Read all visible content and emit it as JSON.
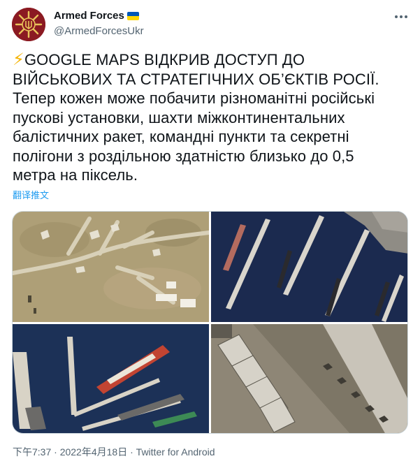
{
  "author": {
    "display_name": "Armed Forces",
    "handle": "@ArmedForcesUkr",
    "flag_colors": [
      "#0057b7",
      "#ffd700"
    ],
    "avatar_bg": "#8b1a22",
    "avatar_icon": "ukraine-armed-forces-emblem"
  },
  "tweet": {
    "headline_line1": "GOOGLE MAPS ВІДКРИВ ДОСТУП ДО",
    "headline_line2": "ВІЙСЬКОВИХ ТА СТРАТЕГІЧНИХ ОБ’ЄКТІВ РОСІЇ.",
    "body_line1": "Тепер кожен може побачити різноманітні російські",
    "body_line2": "пускові установки, шахти міжконтинентальних",
    "body_line3": "балістичних ракет, командні пункти та секретні",
    "body_line4": "полігони з роздільною здатністю близько до 0,5",
    "body_line5": "метра на піксель.",
    "bolt_emoji": "⚡",
    "translate_label": "翻译推文"
  },
  "media": {
    "images": [
      {
        "subject": "airfield-with-aircraft"
      },
      {
        "subject": "naval-pier-with-submarines"
      },
      {
        "subject": "harbor-with-warships"
      },
      {
        "subject": "hangars-with-aircraft"
      }
    ]
  },
  "meta": {
    "time": "下午7:37",
    "separator": "·",
    "date": "2022年4月18日",
    "source": "Twitter for Android"
  },
  "colors": {
    "text": "#0f1419",
    "secondary": "#536471",
    "link": "#1d9bf0",
    "bolt": "#f5b300"
  }
}
